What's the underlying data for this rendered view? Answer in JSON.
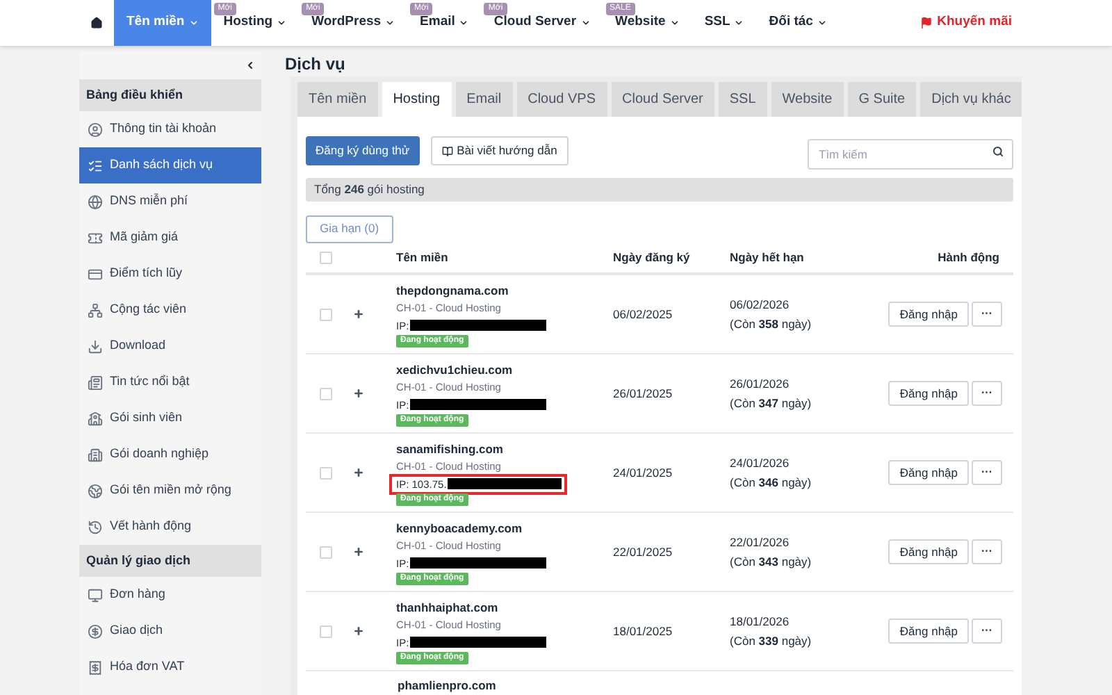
{
  "nav": {
    "items": [
      {
        "label": "Tên miền",
        "selected": true
      },
      {
        "label": "Hosting",
        "badge": "Mới",
        "selected": false
      },
      {
        "label": "WordPress",
        "badge": "Mới",
        "selected": false
      },
      {
        "label": "Email",
        "badge": "Mới",
        "selected": false
      },
      {
        "label": "Cloud Server",
        "badge": "Mới",
        "selected": false
      },
      {
        "label": "Website",
        "badge": "SALE",
        "selected": false
      },
      {
        "label": "SSL",
        "selected": false
      },
      {
        "label": "Đối tác",
        "selected": false
      }
    ],
    "promo": "Khuyến mãi"
  },
  "sidebar": {
    "sections": [
      {
        "title": "Bảng điều khiển",
        "items": [
          {
            "label": "Thông tin tài khoản",
            "selected": false
          },
          {
            "label": "Danh sách dịch vụ",
            "selected": true
          },
          {
            "label": "DNS miễn phí",
            "selected": false
          },
          {
            "label": "Mã giảm giá",
            "selected": false
          },
          {
            "label": "Điểm tích lũy",
            "selected": false
          },
          {
            "label": "Cộng tác viên",
            "selected": false
          },
          {
            "label": "Download",
            "selected": false
          },
          {
            "label": "Tin tức nổi bật",
            "selected": false
          },
          {
            "label": "Gói sinh viên",
            "selected": false
          },
          {
            "label": "Gói doanh nghiệp",
            "selected": false
          },
          {
            "label": "Gói tên miền mở rộng",
            "selected": false
          },
          {
            "label": "Vết hành động",
            "selected": false
          }
        ]
      },
      {
        "title": "Quản lý giao dịch",
        "items": [
          {
            "label": "Đơn hàng",
            "selected": false
          },
          {
            "label": "Giao dịch",
            "selected": false
          },
          {
            "label": "Hóa đơn VAT",
            "selected": false
          }
        ]
      }
    ]
  },
  "page_title": "Dịch vụ",
  "tabs": [
    {
      "label": "Tên miền",
      "selected": false
    },
    {
      "label": "Hosting",
      "selected": true
    },
    {
      "label": "Email",
      "selected": false
    },
    {
      "label": "Cloud VPS",
      "selected": false
    },
    {
      "label": "Cloud Server",
      "selected": false
    },
    {
      "label": "SSL",
      "selected": false
    },
    {
      "label": "Website",
      "selected": false
    },
    {
      "label": "G Suite",
      "selected": false
    },
    {
      "label": "Dịch vụ khác",
      "selected": false
    }
  ],
  "trial_button": "Đăng ký dùng thử",
  "guide_button": "Bài viết hướng dẫn",
  "search": {
    "placeholder": "Tìm kiếm"
  },
  "summary": "Tổng **246** gói hosting",
  "renew_button": "Gia hạn (0)",
  "table": {
    "select_all_checked": false,
    "columns": [
      "Tên miền",
      "Ngày đăng ký",
      "Ngày hết hạn",
      "Hành động"
    ],
    "rows": [
      {
        "domain": "thepdongnama.com",
        "plan": "CH-01 - Cloud Hosting",
        "ip": "IP:",
        "status": "Đang hoạt động",
        "registered": "06/02/2025",
        "expires": "06/02/2026",
        "remaining": "(Còn **358** ngày)",
        "login": "Đăng nhập",
        "more": "···",
        "checked": false,
        "highlighted": false
      },
      {
        "domain": "xedichvu1chieu.com",
        "plan": "CH-01 - Cloud Hosting",
        "ip": "IP:",
        "status": "Đang hoạt động",
        "registered": "26/01/2025",
        "expires": "26/01/2026",
        "remaining": "(Còn **347** ngày)",
        "login": "Đăng nhập",
        "more": "···",
        "checked": false,
        "highlighted": false
      },
      {
        "domain": "sanamifishing.com",
        "plan": "CH-01 - Cloud Hosting",
        "ip": "IP: 103.75.",
        "status": "Đang hoạt động",
        "registered": "24/01/2025",
        "expires": "24/01/2026",
        "remaining": "(Còn **346** ngày)",
        "login": "Đăng nhập",
        "more": "···",
        "checked": false,
        "highlighted": true
      },
      {
        "domain": "kennyboacademy.com",
        "plan": "CH-01 - Cloud Hosting",
        "ip": "IP:",
        "status": "Đang hoạt động",
        "registered": "22/01/2025",
        "expires": "22/01/2026",
        "remaining": "(Còn **343** ngày)",
        "login": "Đăng nhập",
        "more": "···",
        "checked": false,
        "highlighted": false
      },
      {
        "domain": "thanhhaiphat.com",
        "plan": "CH-01 - Cloud Hosting",
        "ip": "IP:",
        "status": "Đang hoạt động",
        "registered": "18/01/2025",
        "expires": "18/01/2026",
        "remaining": "(Còn **339** ngày)",
        "login": "Đăng nhập",
        "more": "···",
        "checked": false,
        "highlighted": false
      }
    ],
    "partial_row": {
      "domain": "phamlienpro.com"
    }
  }
}
